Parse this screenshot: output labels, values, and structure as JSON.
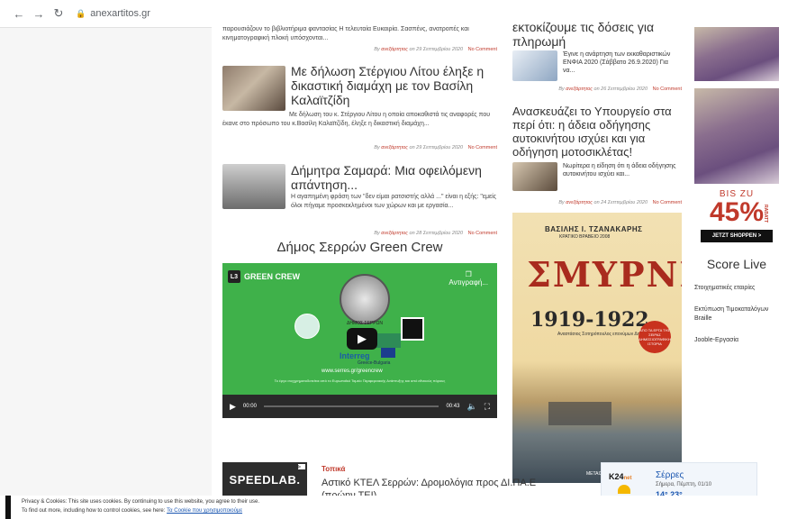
{
  "browser": {
    "url": "anexartitos.gr"
  },
  "left_column": {
    "top_excerpt": "παρουσιάζουν το βιβλιοτήριμα φαντασίας Η τελευταία Ευκαιρία. Σασπένς, ανατροπές και κινηματογραφική πλοκή υπόσχονται...",
    "top_meta": {
      "by": "By",
      "author": "ανεξάρτητος",
      "date": "on 29 Σεπτεμβρίου 2020",
      "comments": "No Comment"
    },
    "posts": [
      {
        "title": "Με δήλωση Στέργιου Λίτου έληξε η δικαστική διαμάχη με τον Βασίλη Καλαϊτζίδη",
        "excerpt": "Με δήλωση του κ. Στέργιου Λίτου η οποία αποκαθιστά τις αναφορές που έκανε στο πρόσωπο του κ.Βασίλη Καλαϊτζίδη, έληξε η δικαστική διαμάχη...",
        "meta": {
          "by": "By",
          "author": "ανεξάρτητος",
          "date": "on 29 Σεπτεμβρίου 2020",
          "comments": "No Comment"
        }
      },
      {
        "title": "Δήμητρα Σαμαρά: Μια οφειλόμενη απάντηση...",
        "excerpt": "Η αγαπημένη φράση  των \"δεν είμαι ρατσιστής αλλά ...\" είναι η εξής: \"εμείς όλοι πήγαμε προσκεκλημένοι των χώρων και με εργασία...",
        "meta": {
          "by": "By",
          "author": "ανεξάρτητος",
          "date": "on 28 Σεπτεμβρίου 2020",
          "comments": "No Comment"
        }
      }
    ],
    "green_crew_heading": "Δήμος Σερρών Green Crew",
    "video": {
      "channel": "GREEN CREW",
      "channel_logo": "L3",
      "copy_label": "Αντιγραφή...",
      "coin_label": "ΔΗΜΟΣ ΣΕΡΡΩΝ",
      "interreg": "Interreg",
      "program": "Greece-Bulgaria",
      "site": "www.serres.gr/greencrew",
      "fine_print": "Το έργο συγχρηματοδοτείται από το Ευρωπαϊκό Ταμείο Περιφερειακής Ανάπτυξης και από εθνικούς πόρους",
      "time_current": "00:00",
      "time_total": "00:43",
      "progress": 0.0
    }
  },
  "mid_column": {
    "top_title_fragment": "εκτοκίζουμε τις δόσεις για πληρωμή",
    "posts": [
      {
        "title": "Έγινε η ανάρτηση των εκκαθαριστικών ΕΝΦΙΑ 2020 (Σάββατο 26.9.2020) Για να...",
        "meta": {
          "by": "By",
          "author": "ανεξάρτητος",
          "date": "on 26 Σεπτεμβρίου 2020",
          "comments": "No Comment"
        }
      },
      {
        "heading": "Ανασκευάζει το Υπουργείο στα περί ότι: η άδεια οδήγησης αυτοκινήτου ισχύει και για οδήγηση μοτοσικλέτας!",
        "excerpt": "Νωρίτερα η είδηση ότι η άδεια οδήγησης αυτοκινήτου ισχύει και...",
        "meta": {
          "by": "By",
          "author": "ανεξάρτητος",
          "date": "on 24 Σεπτεμβρίου 2020",
          "comments": "No Comment"
        }
      }
    ],
    "book_ad": {
      "author": "ΒΑΣΙΛΗΣ Ι. ΤΖΑΝΑΚΑΡΗΣ",
      "award": "ΚΡΑΤΙΚΟ ΒΡΑΒΕΙΟ 2008",
      "title": "ΣΜΥΡΝΗ",
      "years": "1919-1922",
      "byline": "Αναστάσιος Σοτηρόπουλος επονύμων Δημοσιογράφων",
      "badge": "ΑΠΟ ΤΑ ΕΡΓΑ ΤΗΣ ΣΕΙΡΑΣ ΔΗΜΟΣΙΟΓΡΑΦΙΚΗ ΙΣΤΟΡΙΑ",
      "publisher": "ΜΕΤΑΙΧΜΙΟ"
    }
  },
  "right_column": {
    "ad": {
      "bis": "BIS ZU",
      "percent": "45%",
      "rabatt": "RABATT",
      "button": "JETZT SHOPPEN >"
    },
    "score_live": "Score Live",
    "links": [
      "Στοιχηματικές εταιρίες",
      "Εκτύπωση Τιμοκαταλόγων Braille",
      "Jooble-Εργασία"
    ]
  },
  "bottom": {
    "speedlab": "SPEEDLAB.",
    "category": "Τοπικά",
    "headline": "Αστικό ΚΤΕΛ Σερρών: Δρομολόγια προς ΔΙ.ΠΑ.Ε (πρώην ΤΕΙ)",
    "weather": {
      "brand": "K24",
      "brand_suffix": "net",
      "city": "Σέρρες",
      "date": "Σήμερα, Πέμπτη, 01/10",
      "temps": "14° 23°"
    }
  },
  "cookie_bar": {
    "line1": "Privacy & Cookies: This site uses cookies. By continuing to use this website, you agree to their use.",
    "line2_prefix": "To find out more, including how to control cookies, see here:",
    "line2_link": "Τα Cookie που χρησιμοποιούμε"
  },
  "colors": {
    "accent": "#c0392b",
    "video_green": "#3fb14a",
    "link_blue": "#1a56b0"
  }
}
